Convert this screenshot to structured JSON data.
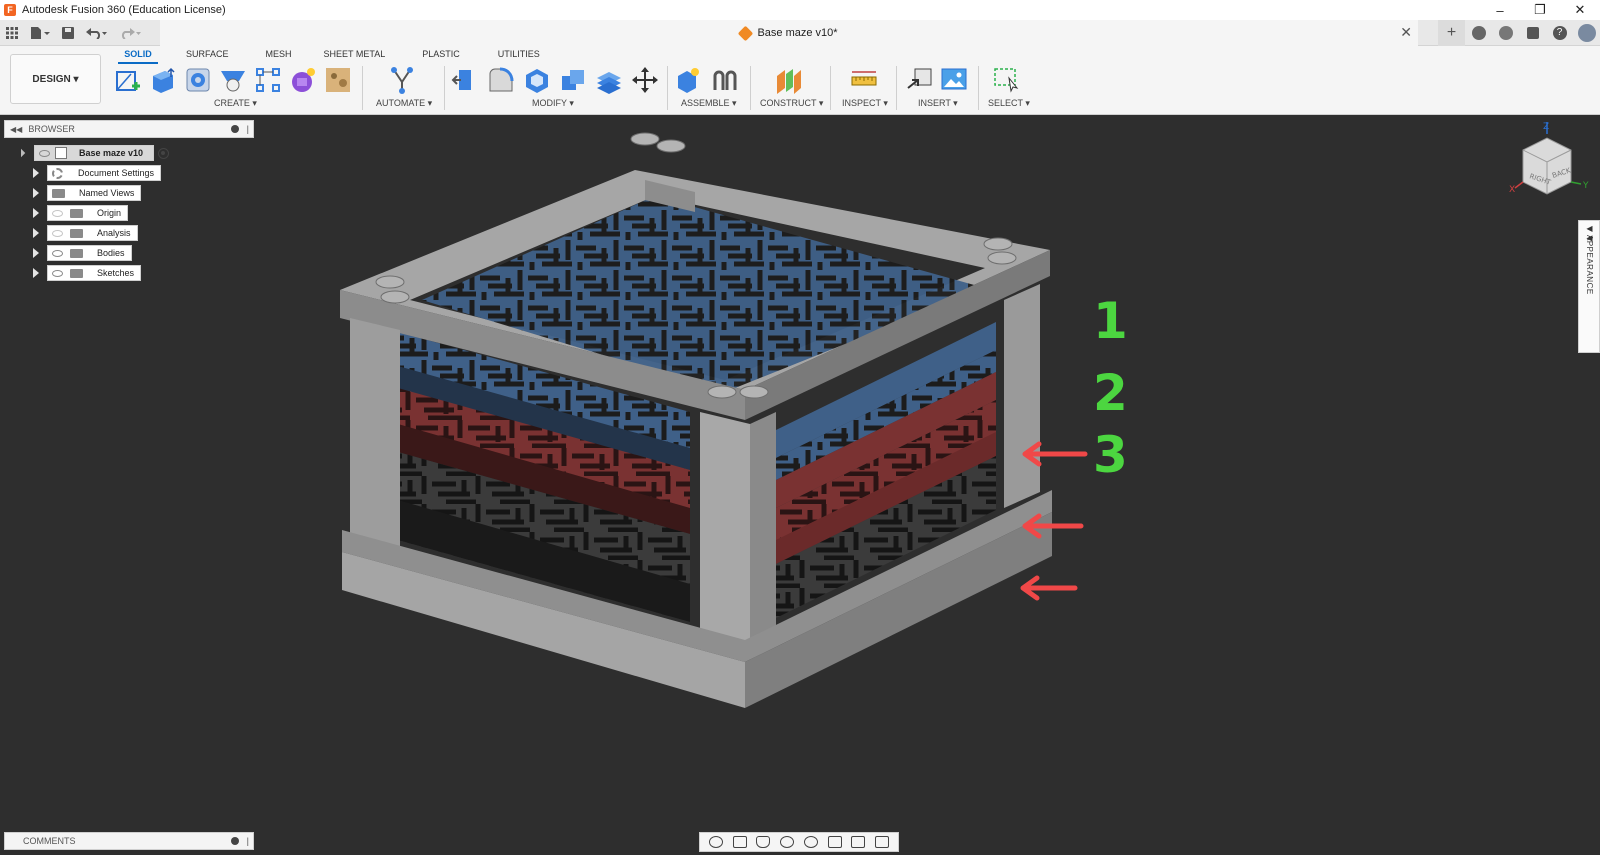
{
  "window": {
    "title": "Autodesk Fusion 360 (Education License)",
    "controls": [
      "–",
      "❐",
      "✕"
    ]
  },
  "document_tab": {
    "title": "Base maze v10*",
    "close": "✕"
  },
  "ribbon": {
    "workspace_label": "DESIGN ▾",
    "tabs": [
      "SOLID",
      "SURFACE",
      "MESH",
      "SHEET METAL",
      "PLASTIC",
      "UTILITIES"
    ],
    "active_tab": "SOLID",
    "groups": [
      "CREATE ▾",
      "AUTOMATE ▾",
      "MODIFY ▾",
      "ASSEMBLE ▾",
      "CONSTRUCT ▾",
      "INSPECT ▾",
      "INSERT ▾",
      "SELECT ▾"
    ]
  },
  "browser": {
    "title": "BROWSER",
    "root": "Base maze v10",
    "nodes": [
      "Document Settings",
      "Named Views",
      "Origin",
      "Analysis",
      "Bodies",
      "Sketches"
    ]
  },
  "viewcube": {
    "faces": [
      "RIGHT",
      "BACK"
    ],
    "axes": [
      "Z",
      "X",
      "Y"
    ]
  },
  "appearance_tab": "APPEARANCE",
  "comments": {
    "title": "COMMENTS"
  },
  "annotations": [
    "1",
    "2",
    "3"
  ],
  "colors": {
    "blue_layer": "#3f6088",
    "red_layer": "#7a3232",
    "dark_layer": "#3a3a3a",
    "frame": "#9a9a9a",
    "arrow": "#f04848",
    "number": "#4cd640",
    "accent": "#0a6bc5"
  }
}
